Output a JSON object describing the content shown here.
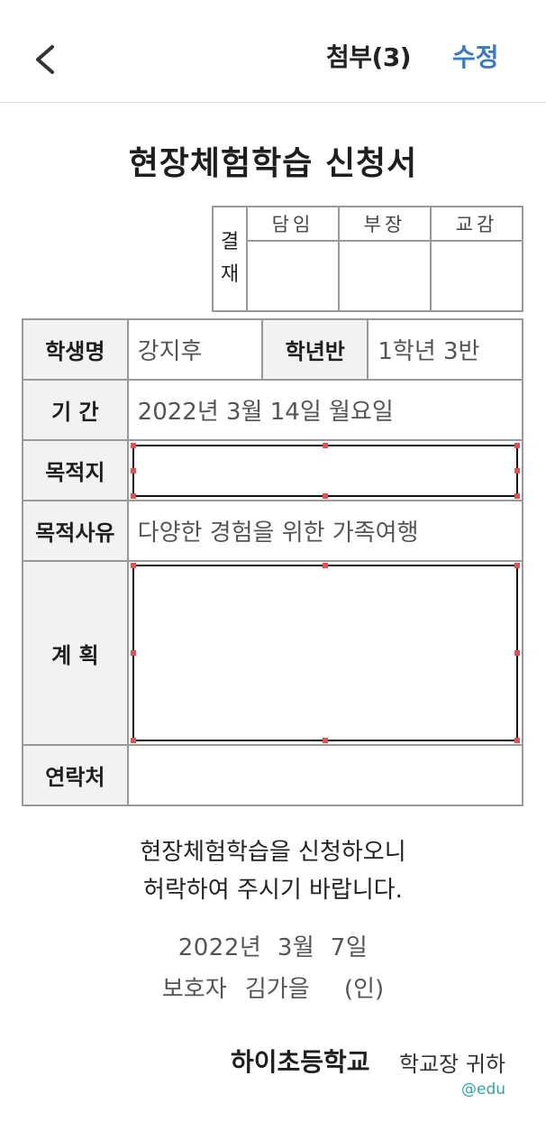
{
  "header": {
    "back_icon": "chevron-left-icon",
    "title": "첨부(3)",
    "edit_label": "수정"
  },
  "document": {
    "title": "현장체험학습 신청서",
    "approval": {
      "label": "결재",
      "label_top": "결",
      "label_bottom": "재",
      "roles": [
        "담임",
        "부장",
        "교감"
      ]
    },
    "fields": {
      "student_name_label": "학생명",
      "student_name": "강지후",
      "grade_class_label": "학년반",
      "grade_class": "1학년 3반",
      "period_label": "기 간",
      "period": "2022년 3월 14일 월요일",
      "destination_label": "목적지",
      "destination": "",
      "purpose_label": "목적사유",
      "purpose": "다양한 경험을 위한 가족여행",
      "plan_label": "계 획",
      "plan": "",
      "contact_label": "연락처",
      "contact": ""
    },
    "closing_line1": "현장체험학습을 신청하오니",
    "closing_line2": "허락하여 주시기 바랍니다.",
    "date": "2022년  3월  7일",
    "guardian_label": "보호자",
    "guardian_name": "김가을",
    "seal": "(인)",
    "school_name": "하이초등학교",
    "addressee": "학교장 귀하",
    "watermark": "@edu"
  },
  "colors": {
    "accent": "#3a78c9",
    "border": "#999999",
    "watermark": "#2aa7a3",
    "handle": "#e25050"
  }
}
